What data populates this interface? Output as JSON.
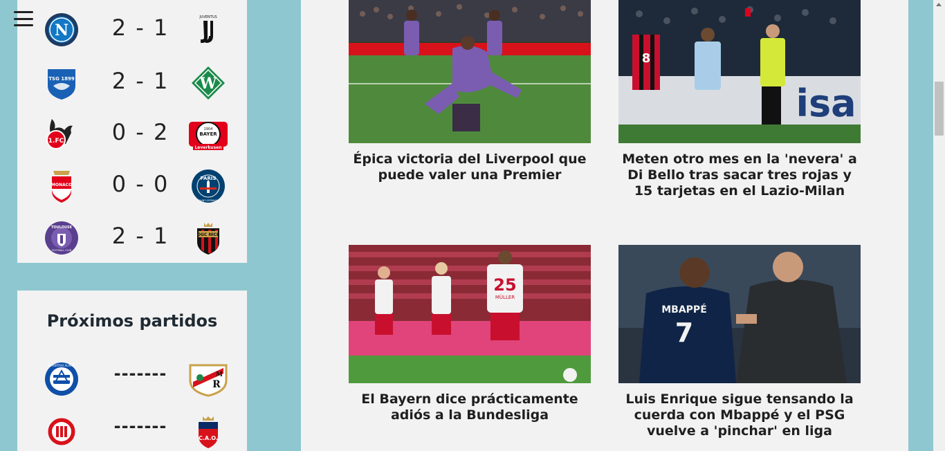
{
  "menu": {
    "icon": "hamburger-menu-icon"
  },
  "results": [
    {
      "home": "Napoli",
      "score": "2 - 1",
      "away": "Juventus"
    },
    {
      "home": "Hoffenheim",
      "score": "2 - 1",
      "away": "Werder Bremen"
    },
    {
      "home": "Köln",
      "score": "0 - 2",
      "away": "Bayer Leverkusen"
    },
    {
      "home": "Monaco",
      "score": "0 - 0",
      "away": "Paris Saint-Germain"
    },
    {
      "home": "Toulouse",
      "score": "2 - 1",
      "away": "Nice"
    }
  ],
  "upcoming": {
    "title": "Próximos partidos",
    "matches": [
      {
        "home": "Alavés",
        "score": "-------",
        "away": "Rayo Vallecano"
      },
      {
        "home": "Girona",
        "score": "-------",
        "away": "Osasuna"
      }
    ]
  },
  "crest_text": {
    "juventus": "JUVENTUS",
    "hoffenheim": "TSG 1899",
    "koln": "1.FC",
    "leverkusen_top": "1904",
    "leverkusen_mid": "BAYER",
    "leverkusen_bottom": "Leverkusen",
    "monaco": "MONACO",
    "psg": "PARIS",
    "psg_ring": "SAINT-GERMAIN",
    "toulouse_top": "TOULOUSE",
    "toulouse_bottom": "FOOTBALL CLUB",
    "nice": "OGC NICE",
    "alaves": "DEPORTIVO ALAVÉS",
    "osasuna": "C.A.O."
  },
  "news": [
    {
      "title": "Épica victoria del Liverpool que puede valer una Premier",
      "image": "liverpool-celebration-photo"
    },
    {
      "title": "Meten otro mes en la 'nevera' a Di Bello tras sacar tres rojas y 15 tarjetas en el Lazio-Milan",
      "image": "referee-red-card-photo"
    },
    {
      "title": "El Bayern dice prácticamente adiós a la Bundesliga",
      "image": "bayern-players-dejected-photo"
    },
    {
      "title": "Luis Enrique sigue tensando la cuerda con Mbappé y el PSG vuelve a 'pinchar' en liga",
      "image": "mbappe-luis-enrique-photo",
      "shirt_name": "MBAPPÉ",
      "shirt_number": "7"
    }
  ],
  "photo_text": {
    "bayern_shirt_name": "MÜLLER",
    "bayern_shirt_number": "25",
    "milan_shirt_number": "8",
    "board_text": "isa"
  },
  "colors": {
    "background": "#8fc7d0",
    "panel": "#f2f2f2",
    "text": "#1f1f1f"
  }
}
